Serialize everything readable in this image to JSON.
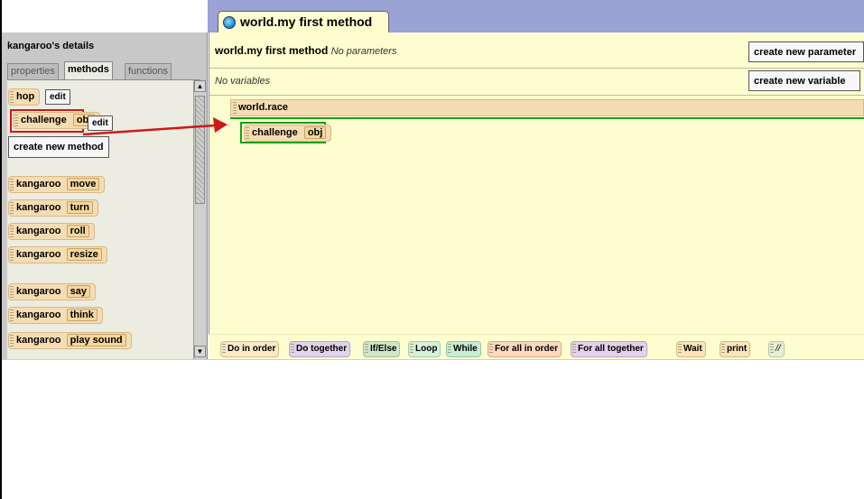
{
  "editor_tab": {
    "title": "world.my first method"
  },
  "left_panel": {
    "title": "kangaroo's details",
    "tabs": [
      {
        "label": "properties",
        "active": false
      },
      {
        "label": "methods",
        "active": true
      },
      {
        "label": "functions",
        "active": false
      }
    ],
    "methods": [
      {
        "name": "hop",
        "edit": "edit"
      },
      {
        "name": "challenge",
        "param": "obj",
        "edit": "edit"
      }
    ],
    "create_method_label": "create new method",
    "builtins": [
      {
        "obj": "kangaroo",
        "method": "move"
      },
      {
        "obj": "kangaroo",
        "method": "turn"
      },
      {
        "obj": "kangaroo",
        "method": "roll"
      },
      {
        "obj": "kangaroo",
        "method": "resize"
      },
      {
        "obj": "kangaroo",
        "method": "say"
      },
      {
        "obj": "kangaroo",
        "method": "think"
      },
      {
        "obj": "kangaroo",
        "method": "play sound"
      }
    ]
  },
  "editor": {
    "method_name": "world.my first method",
    "params_note": "No parameters",
    "create_param_label": "create new parameter",
    "vars_note": "No variables",
    "create_var_label": "create new variable",
    "block_header": "world.race",
    "statement": {
      "name": "challenge",
      "param": "obj"
    }
  },
  "controls": [
    "Do in order",
    "Do together",
    "If/Else",
    "Loop",
    "While",
    "For all in order",
    "For all together",
    "Wait",
    "print",
    "//"
  ],
  "colors": {
    "highlight_red": "#d01818",
    "highlight_green": "#18a018",
    "editor_bg": "#fdfdd0",
    "top_band": "#9aa2d6"
  }
}
